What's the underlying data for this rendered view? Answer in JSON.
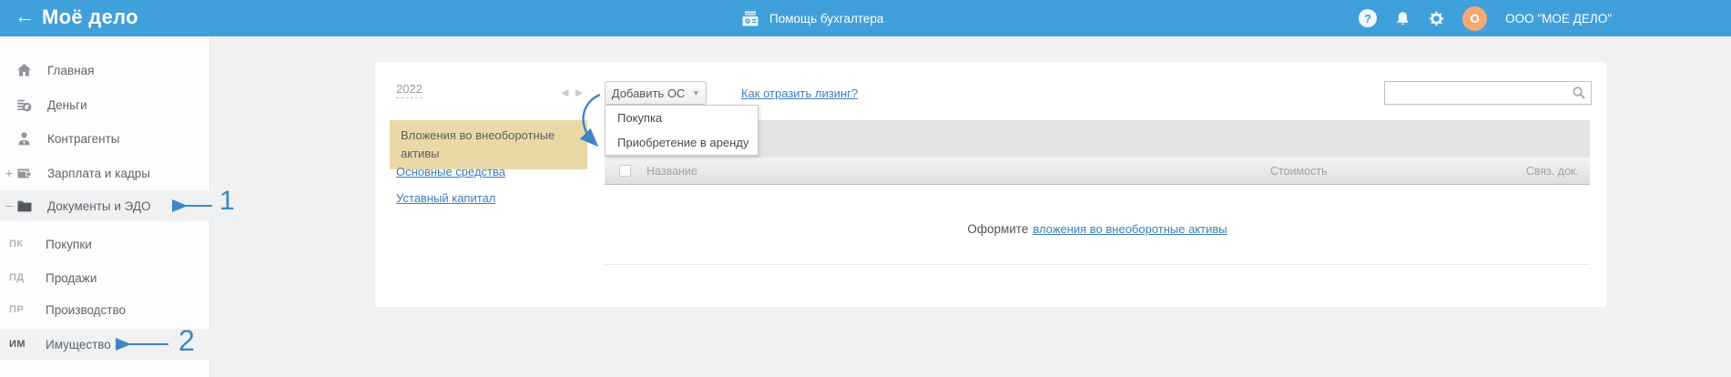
{
  "topbar": {
    "logo": "Моё дело",
    "help_center_label": "Помощь бухгалтера",
    "company": "ООО \"МОЕ ДЕЛО\"",
    "avatar_letter": "О"
  },
  "sidebar": {
    "items": [
      {
        "label": "Главная"
      },
      {
        "label": "Деньги"
      },
      {
        "label": "Контрагенты"
      },
      {
        "label": "Зарплата и кадры",
        "expand": "+"
      },
      {
        "label": "Документы и ЭДО",
        "expand": "−"
      }
    ],
    "subitems": [
      {
        "prefix": "ПК",
        "label": "Покупки"
      },
      {
        "prefix": "ПД",
        "label": "Продажи"
      },
      {
        "prefix": "ПР",
        "label": "Производство"
      },
      {
        "prefix": "ИМ",
        "label": "Имущество"
      }
    ]
  },
  "annotations": {
    "step1": "1",
    "step2": "2"
  },
  "main": {
    "year": "2022",
    "add_button_label": "Добавить ОС",
    "dropdown_items": [
      "Покупка",
      "Приобретение в аренду"
    ],
    "leasing_link": "Как отразить лизинг?",
    "subnav": {
      "active_item": "Вложения во внеоборотные активы",
      "link1": "Основные средства",
      "link2": "Уставный капитал"
    },
    "table": {
      "columns": [
        "Название",
        "Стоимость",
        "Связ. док."
      ]
    },
    "empty_state": {
      "text": "Оформите",
      "link": "вложения во внеоборотные активы"
    }
  },
  "icons": {
    "back_arrow": "←",
    "prev_arrow": "◀",
    "next_arrow": "▶",
    "caret_down": "▼",
    "question_mark": "?"
  },
  "colors": {
    "topbar_blue": "#3FA0DB",
    "link_blue": "#3B7DC0",
    "annotation_blue": "#4185C6",
    "highlight_tan": "#EBD8A7",
    "avatar_orange": "#F2A978"
  }
}
